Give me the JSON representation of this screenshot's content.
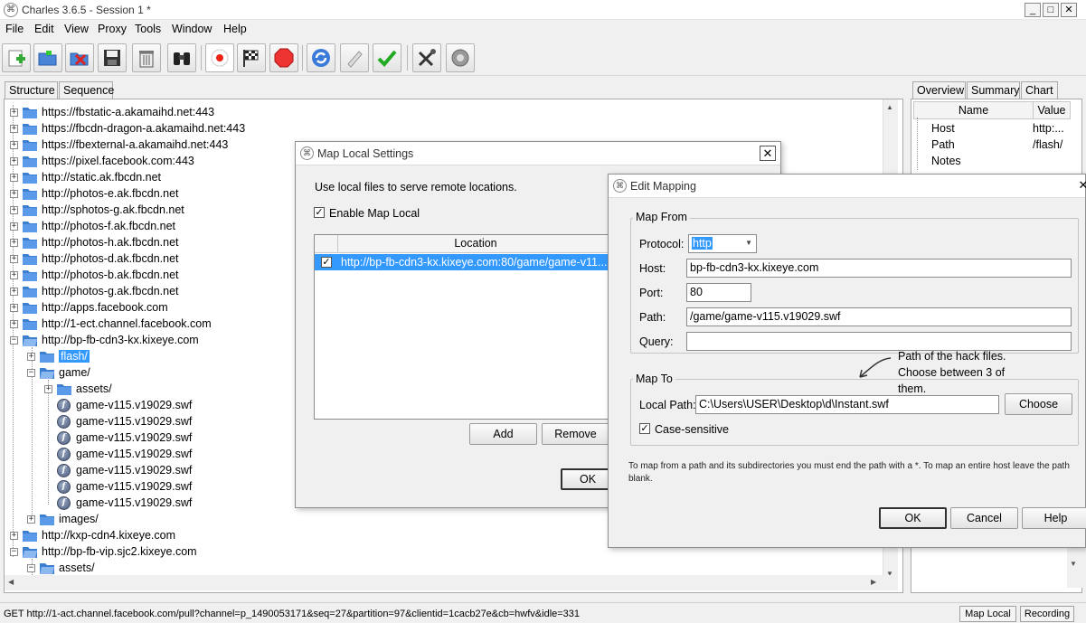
{
  "window": {
    "title": "Charles 3.6.5 - Session 1 *"
  },
  "menu": [
    "File",
    "Edit",
    "View",
    "Proxy",
    "Tools",
    "Window",
    "Help"
  ],
  "left_tabs": [
    "Structure",
    "Sequence"
  ],
  "right_tabs": [
    "Overview",
    "Summary",
    "Chart"
  ],
  "tree": [
    "https://fbstatic-a.akamaihd.net:443",
    "https://fbcdn-dragon-a.akamaihd.net:443",
    "https://fbexternal-a.akamaihd.net:443",
    "https://pixel.facebook.com:443",
    "http://static.ak.fbcdn.net",
    "http://photos-e.ak.fbcdn.net",
    "http://sphotos-g.ak.fbcdn.net",
    "http://photos-f.ak.fbcdn.net",
    "http://photos-h.ak.fbcdn.net",
    "http://photos-d.ak.fbcdn.net",
    "http://photos-b.ak.fbcdn.net",
    "http://photos-g.ak.fbcdn.net",
    "http://apps.facebook.com",
    "http://1-ect.channel.facebook.com",
    "http://bp-fb-cdn3-kx.kixeye.com",
    "flash/",
    "game/",
    "assets/",
    "game-v115.v19029.swf",
    "game-v115.v19029.swf",
    "game-v115.v19029.swf",
    "game-v115.v19029.swf",
    "game-v115.v19029.swf",
    "game-v115.v19029.swf",
    "game-v115.v19029.swf",
    "images/",
    "http://kxp-cdn4.kixeye.com",
    "http://bp-fb-vip.sjc2.kixeye.com",
    "assets/"
  ],
  "overview": {
    "col_name": "Name",
    "col_value": "Value",
    "rows": [
      {
        "name": "Host",
        "value": "http:..."
      },
      {
        "name": "Path",
        "value": "/flash/"
      },
      {
        "name": "Notes",
        "value": ""
      }
    ]
  },
  "map_local": {
    "title": "Map Local Settings",
    "description": "Use local files to serve remote locations.",
    "enable_label": "Enable Map Local",
    "location_header": "Location",
    "location_row": "http://bp-fb-cdn3-kx.kixeye.com:80/game/game-v11...",
    "add": "Add",
    "remove": "Remove",
    "ok": "OK"
  },
  "edit_mapping": {
    "title": "Edit Mapping",
    "map_from": "Map From",
    "protocol_label": "Protocol:",
    "protocol_value": "http",
    "host_label": "Host:",
    "host_value": "bp-fb-cdn3-kx.kixeye.com",
    "port_label": "Port:",
    "port_value": "80",
    "path_label": "Path:",
    "path_value": "/game/game-v115.v19029.swf",
    "query_label": "Query:",
    "query_value": "",
    "map_to": "Map To",
    "local_path_label": "Local Path:",
    "local_path_value": "C:\\Users\\USER\\Desktop\\d\\Instant.swf",
    "choose": "Choose",
    "case_sensitive": "Case-sensitive",
    "annotation": "Path of the hack files. Choose between 3 of them.",
    "hint": "To map from a path and its subdirectories you must end the path with a *. To map an entire host leave the path blank.",
    "ok": "OK",
    "cancel": "Cancel",
    "help": "Help"
  },
  "status": {
    "text": "GET http://1-act.channel.facebook.com/pull?channel=p_1490053171&seq=27&partition=97&clientid=1cacb27e&cb=hwfv&idle=331",
    "map_local": "Map Local",
    "recording": "Recording"
  }
}
